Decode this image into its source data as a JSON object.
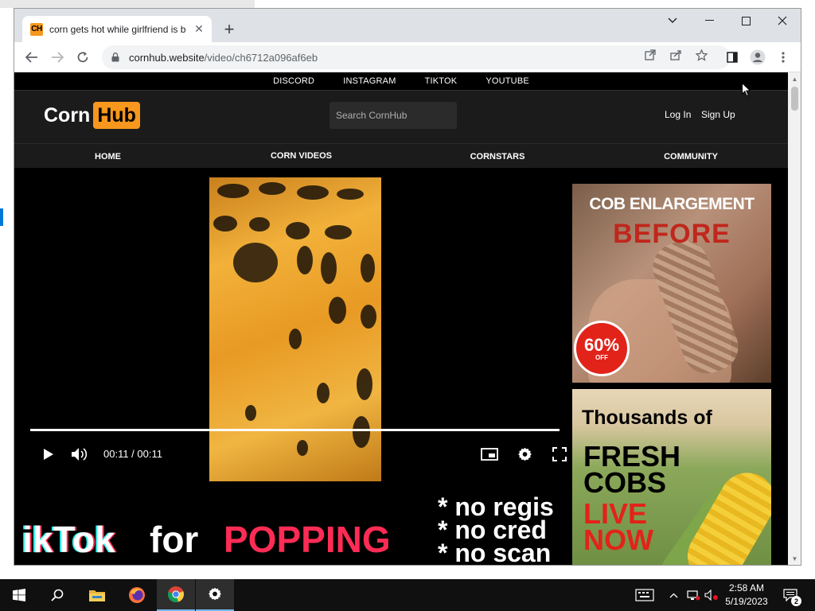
{
  "browser": {
    "tab_title": "corn gets hot while girlfriend is b",
    "favicon_text": "CH",
    "url_domain": "cornhub.website",
    "url_path": "/video/ch6712a096af6eb"
  },
  "site": {
    "social_links": [
      "DISCORD",
      "INSTAGRAM",
      "TIKTOK",
      "YOUTUBE"
    ],
    "logo_part1": "Corn",
    "logo_part2": "Hub",
    "search_placeholder": "Search CornHub",
    "login_label": "Log In",
    "signup_label": "Sign Up",
    "nav": [
      "HOME",
      "CORN VIDEOS",
      "CORNSTARS",
      "COMMUNITY"
    ],
    "nav_active_index": 1,
    "accent_color": "#f7971d"
  },
  "video": {
    "time_display": "00:11 / 00:11",
    "progress_fraction": 1.0
  },
  "ads": {
    "ad1": {
      "title": "COB ENLARGEMENT",
      "subtitle": "BEFORE",
      "badge_percent": "60%",
      "badge_off": "OFF"
    },
    "ad2": {
      "line1": "Thousands of",
      "line2a": "FRESH",
      "line2b": "COBS",
      "line3a": "LIVE",
      "line3b": "NOW"
    }
  },
  "banner": {
    "tiktok": "ikTok",
    "for": "for",
    "popping": "POPPING",
    "list": [
      "* no regis",
      "* no cred",
      "* no scan"
    ]
  },
  "taskbar": {
    "time": "2:58 AM",
    "date": "5/19/2023",
    "notification_count": "2"
  }
}
